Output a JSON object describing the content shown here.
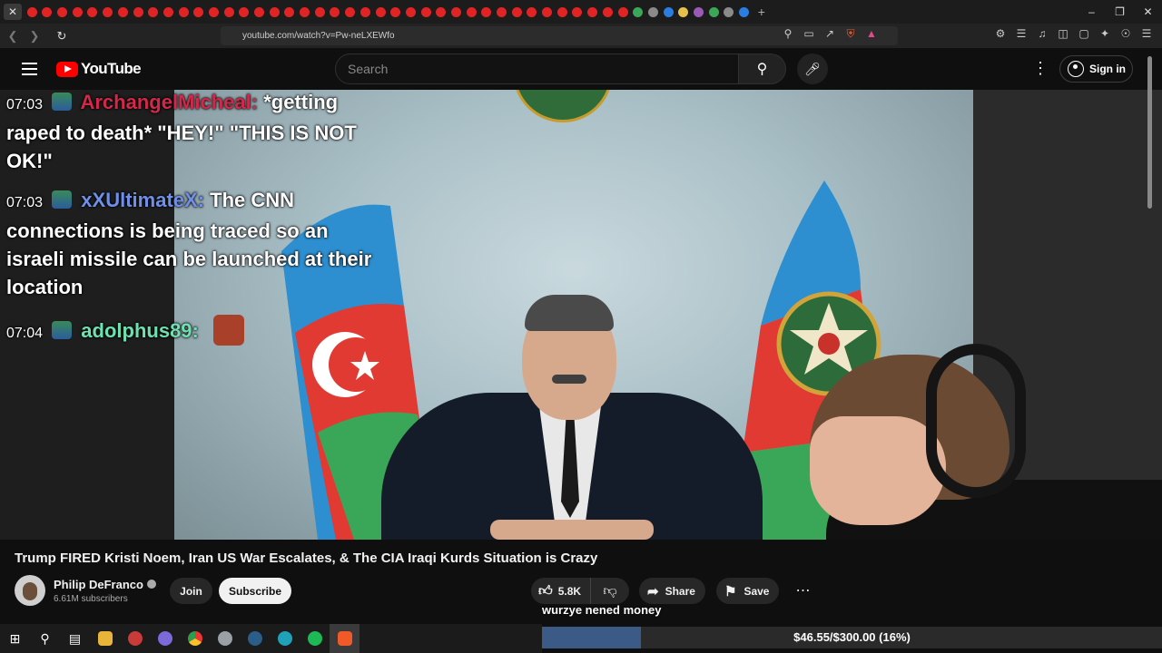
{
  "browser": {
    "url": "youtube.com/watch?v=Pw-neLXEWfo",
    "new_tab_symbol": "+",
    "window_controls": [
      "–",
      "❐",
      "✕"
    ],
    "active_tab_close": "✕"
  },
  "youtube": {
    "logo_text": "YouTube",
    "search_placeholder": "Search",
    "sign_in_label": "Sign in"
  },
  "chat": {
    "messages": [
      {
        "time": "07:03",
        "user": "ArchangelMicheal",
        "text": "*getting raped to death* \"HEY!\" \"THIS IS NOT OK!\"",
        "color": "#d2284a"
      },
      {
        "time": "07:03",
        "user": "xXUltimateX",
        "text": "The CNN connections is being traced so an israeli missile can be launched at their location",
        "color": "#6f8fe8"
      },
      {
        "time": "07:04",
        "user": "adolphus89",
        "text": "",
        "color": "#6fe0b0"
      }
    ]
  },
  "video": {
    "title": "Trump FIRED Kristi Noem, Iran US War Escalates, & The CIA Iraqi Kurds Situation is Crazy",
    "channel_name": "Philip DeFranco",
    "channel_avatar_text": "PDS",
    "subscribers": "6.61M subscribers",
    "join_label": "Join",
    "subscribe_label": "Subscribe",
    "likes": "5.8K",
    "share_label": "Share",
    "save_label": "Save"
  },
  "donation": {
    "label": "wurzye nened money",
    "progress_text": "$46.55/$300.00 (16%)",
    "progress_fraction": 0.16,
    "fill_color": "#3c5a86"
  },
  "colors": {
    "yt_red": "#ff0000",
    "background": "#0f0f0f"
  }
}
